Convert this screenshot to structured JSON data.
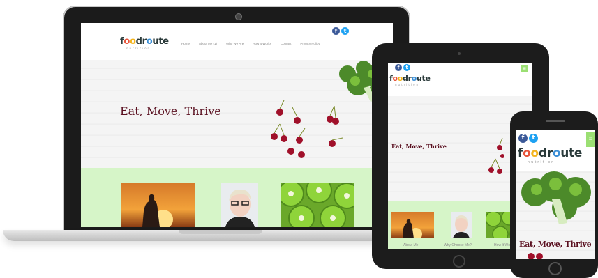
{
  "brand": {
    "logo_parts": [
      "f",
      "o",
      "o",
      "d",
      "r",
      "o",
      "u",
      "te"
    ],
    "logo_text": "foodroute",
    "logo_sub": "nutrition"
  },
  "laptop": {
    "nav": [
      "Home",
      "About Me (1)",
      "Who We Are",
      "How It Works",
      "Contact",
      "Privacy Policy"
    ],
    "hero_title": "Eat, Move, Thrive"
  },
  "tablet": {
    "hero_title": "Eat, Move, Thrive",
    "captions": [
      "About Me",
      "Why Choose Me?",
      "How It Works"
    ]
  },
  "phone": {
    "hero_title": "Eat, Move, Thrive"
  },
  "social": {
    "facebook_glyph": "f",
    "twitter_glyph": "t"
  },
  "menu_glyph": "≡",
  "colors": {
    "hero_text": "#5a1020",
    "green_band": "#d6f5c8",
    "menu_green": "#9bdf73"
  }
}
